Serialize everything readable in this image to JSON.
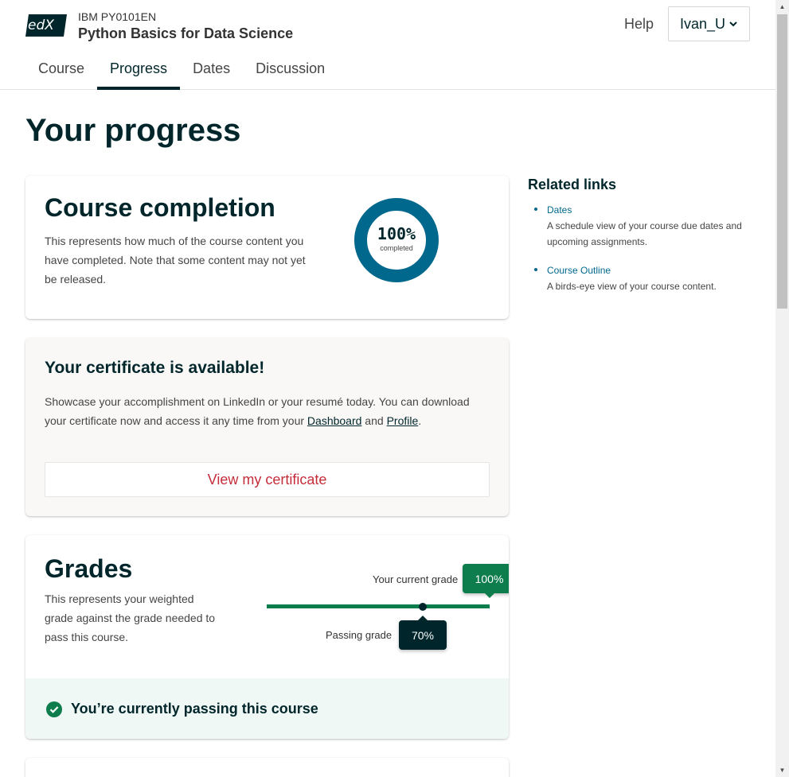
{
  "header": {
    "logo_text": "edX",
    "course_org": "IBM PY0101EN",
    "course_title": "Python Basics for Data Science",
    "help_label": "Help",
    "username": "Ivan_U"
  },
  "tabs": [
    {
      "label": "Course",
      "active": false
    },
    {
      "label": "Progress",
      "active": true
    },
    {
      "label": "Dates",
      "active": false
    },
    {
      "label": "Discussion",
      "active": false
    }
  ],
  "page_title": "Your progress",
  "completion": {
    "title": "Course completion",
    "description": "This represents how much of the course content you have completed. Note that some content may not yet be released.",
    "percent": 100,
    "percent_label": "100%",
    "sublabel": "completed"
  },
  "certificate": {
    "title": "Your certificate is available!",
    "text_before": "Showcase your accomplishment on LinkedIn or your resumé today. You can download your certificate now and access it any time from your ",
    "dashboard_link": "Dashboard",
    "text_middle": " and ",
    "profile_link": "Profile",
    "text_after": ".",
    "button_label": "View my certificate"
  },
  "grades": {
    "title": "Grades",
    "description": "This represents your weighted grade against the grade needed to pass this course.",
    "current_label": "Your current grade",
    "current_value": "100%",
    "current_fraction": 1.0,
    "passing_label": "Passing grade",
    "passing_value": "70%",
    "passing_fraction": 0.7,
    "pass_message": "You’re currently passing this course"
  },
  "related": {
    "title": "Related links",
    "items": [
      {
        "label": "Dates",
        "description": "A schedule view of your course due dates and upcoming assignments."
      },
      {
        "label": "Course Outline",
        "description": "A birds-eye view of your course content."
      }
    ]
  },
  "colors": {
    "brand_dark": "#00262b",
    "donut": "#00688d",
    "success": "#0d7d4d",
    "cert_button_text": "#c32d3a"
  }
}
